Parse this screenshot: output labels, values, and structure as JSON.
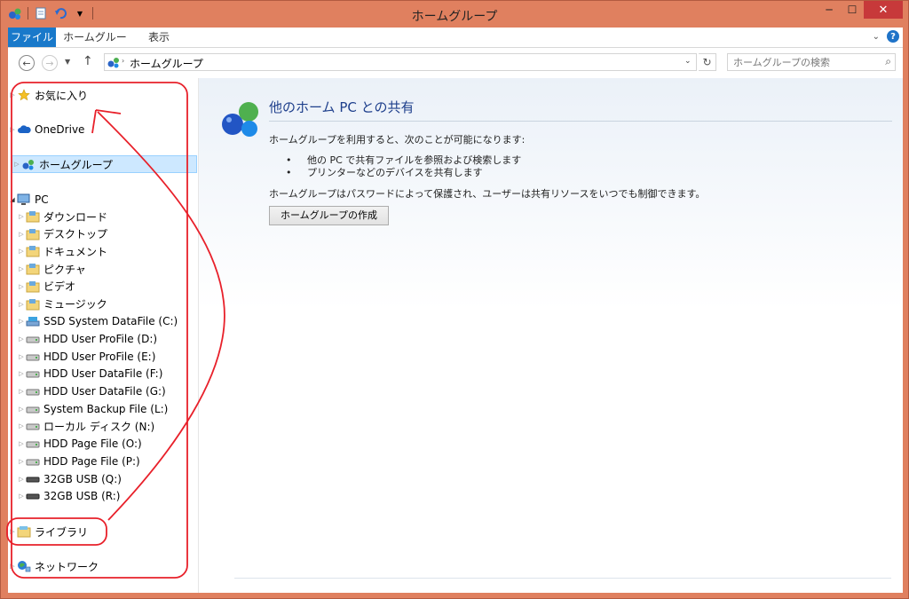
{
  "window": {
    "title": "ホームグループ"
  },
  "ribbon": {
    "tabs": [
      "ファイル",
      "ホームグループ",
      "表示"
    ]
  },
  "address": {
    "path": "ホームグループ"
  },
  "search": {
    "placeholder": "ホームグループの検索"
  },
  "nav": {
    "favorites": "お気に入り",
    "onedrive": "OneDrive",
    "homegroup": "ホームグループ",
    "pc": "PC",
    "pc_items": [
      "ダウンロード",
      "デスクトップ",
      "ドキュメント",
      "ピクチャ",
      "ビデオ",
      "ミュージック",
      "SSD System DataFile (C:)",
      "HDD User ProFile (D:)",
      "HDD User ProFile (E:)",
      "HDD User DataFile (F:)",
      "HDD User DataFile (G:)",
      "System Backup File (L:)",
      "ローカル ディスク (N:)",
      "HDD Page File (O:)",
      "HDD Page File (P:)",
      "32GB USB (Q:)",
      "32GB USB (R:)"
    ],
    "libraries": "ライブラリ",
    "network": "ネットワーク"
  },
  "main": {
    "heading": "他のホーム PC との共有",
    "intro": "ホームグループを利用すると、次のことが可能になります:",
    "bullets": [
      "他の PC で共有ファイルを参照および検索します",
      "プリンターなどのデバイスを共有します"
    ],
    "note": "ホームグループはパスワードによって保護され、ユーザーは共有リソースをいつでも制御できます。",
    "create_button": "ホームグループの作成"
  },
  "colors": {
    "titlebar": "#e0805f",
    "accent": "#1979ca",
    "close": "#c7393a",
    "annotation": "#e8202a"
  }
}
